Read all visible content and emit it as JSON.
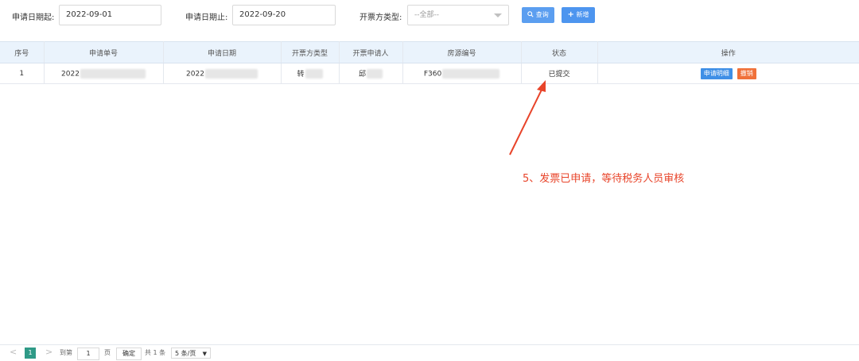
{
  "filters": {
    "start_label": "申请日期起:",
    "start_value": "2022-09-01",
    "end_label": "申请日期止:",
    "end_value": "2022-09-20",
    "type_label": "开票方类型:",
    "type_value": "--全部--",
    "query_button": "查询",
    "add_button": "新增"
  },
  "table": {
    "headers": [
      "序号",
      "申请单号",
      "申请日期",
      "开票方类型",
      "开票申请人",
      "房源编号",
      "状态",
      "操作"
    ],
    "rows": [
      {
        "index": "1",
        "apply_no": "2022",
        "apply_date": "2022",
        "issuer_type": "转",
        "applicant": "邱",
        "house_no": "F360",
        "status": "已提交",
        "detail_button": "申请明细",
        "cancel_button": "撤销"
      }
    ]
  },
  "annotation": {
    "text": "5、发票已申请，等待税务人员审核",
    "color": "#e8442a"
  },
  "pagination": {
    "prev": "<",
    "current_page": "1",
    "next": ">",
    "goto_label": "到第",
    "goto_value": "1",
    "page_suffix": "页",
    "confirm": "确定",
    "total": "共 1 条",
    "page_size": "5 条/页"
  },
  "colors": {
    "primary": "#4d95ef",
    "danger": "#f0713a",
    "header_bg": "#eaf3fc",
    "pager_active": "#2f9a87"
  }
}
